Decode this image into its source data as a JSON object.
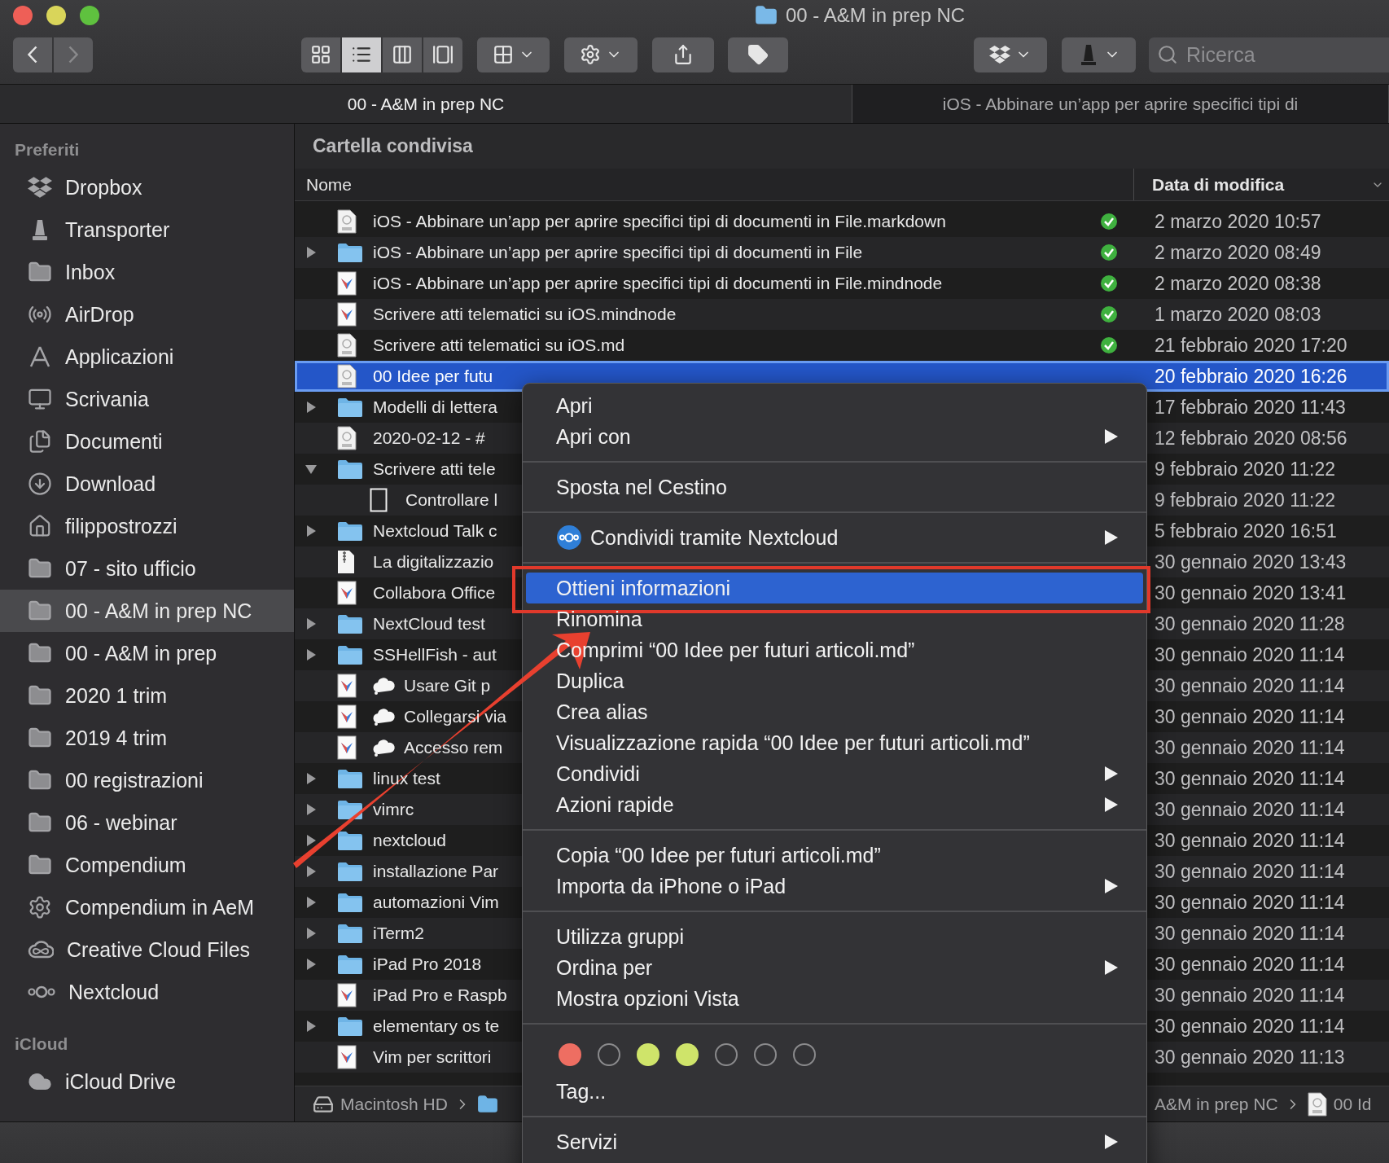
{
  "window": {
    "title": "00 - A&M in prep NC"
  },
  "toolbar": {
    "view_modes": [
      {
        "selected": false
      },
      {
        "selected": true
      },
      {
        "selected": false
      },
      {
        "selected": false
      }
    ],
    "search": {
      "placeholder": "Ricerca"
    }
  },
  "tabs": [
    {
      "label": "00 - A&M in prep NC",
      "selected": true
    },
    {
      "label": "iOS - Abbinare un’app per aprire specifici tipi di",
      "selected": false
    }
  ],
  "sidebar": {
    "sections": [
      {
        "heading": "Preferiti",
        "items": [
          {
            "label": "Dropbox",
            "kind": "dropbox",
            "selected": false
          },
          {
            "label": "Transporter",
            "kind": "transporter",
            "selected": false
          },
          {
            "label": "Inbox",
            "kind": "folder",
            "selected": false
          },
          {
            "label": "AirDrop",
            "kind": "airdrop",
            "selected": false
          },
          {
            "label": "Applicazioni",
            "kind": "apps",
            "selected": false
          },
          {
            "label": "Scrivania",
            "kind": "desktop",
            "selected": false
          },
          {
            "label": "Documenti",
            "kind": "documents",
            "selected": false
          },
          {
            "label": "Download",
            "kind": "download",
            "selected": false
          },
          {
            "label": "filippostrozzi",
            "kind": "home",
            "selected": false
          },
          {
            "label": "07 - sito ufficio",
            "kind": "folder",
            "selected": false
          },
          {
            "label": "00 - A&M in prep NC",
            "kind": "folder",
            "selected": true
          },
          {
            "label": "00 - A&M in prep",
            "kind": "folder",
            "selected": false
          },
          {
            "label": "2020 1 trim",
            "kind": "folder",
            "selected": false
          },
          {
            "label": "2019 4 trim",
            "kind": "folder",
            "selected": false
          },
          {
            "label": "00 registrazioni",
            "kind": "folder",
            "selected": false
          },
          {
            "label": "06 - webinar",
            "kind": "folder",
            "selected": false
          },
          {
            "label": "Compendium",
            "kind": "folder",
            "selected": false
          },
          {
            "label": "Compendium in AeM",
            "kind": "gear",
            "selected": false
          },
          {
            "label": "Creative Cloud Files",
            "kind": "creative-cloud",
            "selected": false
          },
          {
            "label": "Nextcloud",
            "kind": "nextcloud",
            "selected": false
          }
        ]
      },
      {
        "heading": "iCloud",
        "items": [
          {
            "label": "iCloud Drive",
            "kind": "icloud",
            "selected": false
          }
        ]
      }
    ]
  },
  "content": {
    "header": "Cartella condivisa",
    "columns": [
      "Nome",
      "Data di modifica"
    ],
    "rows": [
      {
        "kind": "markdown",
        "name": "iOS - Abbinare un’app per aprire specifici tipi di documenti in File.markdown",
        "date": "2 marzo 2020 10:57",
        "synced": true,
        "cloud": false,
        "selected": false
      },
      {
        "kind": "folder",
        "name": "iOS - Abbinare un’app per aprire specifici tipi di documenti in File",
        "date": "2 marzo 2020 08:49",
        "synced": true,
        "cloud": false,
        "selected": false,
        "expanded": false
      },
      {
        "kind": "mindnode",
        "name": "iOS - Abbinare un’app per aprire specifici tipi di documenti in File.mindnode",
        "date": "2 marzo 2020 08:38",
        "synced": true,
        "cloud": false,
        "selected": false
      },
      {
        "kind": "mindnode",
        "name": "Scrivere atti telematici su iOS.mindnode",
        "date": "1 marzo 2020 08:03",
        "synced": true,
        "cloud": false,
        "selected": false
      },
      {
        "kind": "markdown",
        "name": "Scrivere atti telematici su iOS.md",
        "date": "21 febbraio 2020 17:20",
        "synced": true,
        "cloud": false,
        "selected": false
      },
      {
        "kind": "markdown",
        "name": "00 Idee per futu",
        "date": "20 febbraio 2020 16:26",
        "synced": false,
        "cloud": false,
        "selected": true
      },
      {
        "kind": "folder",
        "name": "Modelli di lettera",
        "date": "17 febbraio 2020 11:43",
        "synced": false,
        "cloud": false,
        "selected": false,
        "expanded": false
      },
      {
        "kind": "markdown",
        "name": "2020-02-12 - #",
        "date": "12 febbraio 2020 08:56",
        "synced": false,
        "cloud": false,
        "selected": false
      },
      {
        "kind": "folder",
        "name": "Scrivere atti tele",
        "date": "9 febbraio 2020 11:22",
        "synced": false,
        "cloud": false,
        "selected": false,
        "expanded": true,
        "children": [
          {
            "kind": "blank",
            "name": "Controllare l",
            "date": "9 febbraio 2020 11:22",
            "synced": false,
            "cloud": false,
            "selected": false
          }
        ]
      },
      {
        "kind": "folder",
        "name": "Nextcloud Talk c",
        "date": "5 febbraio 2020 16:51",
        "synced": false,
        "cloud": false,
        "selected": false,
        "expanded": false
      },
      {
        "kind": "zip",
        "name": "La digitalizzazio",
        "date": "30 gennaio 2020 13:43",
        "synced": false,
        "cloud": false,
        "selected": false
      },
      {
        "kind": "mindnode",
        "name": "Collabora Office",
        "date": "30 gennaio 2020 13:41",
        "synced": false,
        "cloud": false,
        "selected": false
      },
      {
        "kind": "folder",
        "name": "NextCloud test",
        "date": "30 gennaio 2020 11:28",
        "synced": false,
        "cloud": false,
        "selected": false,
        "expanded": false
      },
      {
        "kind": "folder",
        "name": "SSHellFish - aut",
        "date": "30 gennaio 2020 11:14",
        "synced": false,
        "cloud": false,
        "selected": false,
        "expanded": false
      },
      {
        "kind": "mindnode",
        "name": "Usare Git p",
        "date": "30 gennaio 2020 11:14",
        "synced": false,
        "cloud": true,
        "selected": false
      },
      {
        "kind": "mindnode",
        "name": "Collegarsi via",
        "date": "30 gennaio 2020 11:14",
        "synced": false,
        "cloud": true,
        "selected": false
      },
      {
        "kind": "mindnode",
        "name": "Accesso rem",
        "date": "30 gennaio 2020 11:14",
        "synced": false,
        "cloud": true,
        "selected": false
      },
      {
        "kind": "folder",
        "name": "linux test",
        "date": "30 gennaio 2020 11:14",
        "synced": false,
        "cloud": false,
        "selected": false,
        "expanded": false
      },
      {
        "kind": "folder",
        "name": "vimrc",
        "date": "30 gennaio 2020 11:14",
        "synced": false,
        "cloud": false,
        "selected": false,
        "expanded": false
      },
      {
        "kind": "folder",
        "name": "nextcloud",
        "date": "30 gennaio 2020 11:14",
        "synced": false,
        "cloud": false,
        "selected": false,
        "expanded": false
      },
      {
        "kind": "folder",
        "name": "installazione Par",
        "date": "30 gennaio 2020 11:14",
        "synced": false,
        "cloud": false,
        "selected": false,
        "expanded": false
      },
      {
        "kind": "folder",
        "name": "automazioni Vim",
        "date": "30 gennaio 2020 11:14",
        "synced": false,
        "cloud": false,
        "selected": false,
        "expanded": false
      },
      {
        "kind": "folder",
        "name": "iTerm2",
        "date": "30 gennaio 2020 11:14",
        "synced": false,
        "cloud": false,
        "selected": false,
        "expanded": false
      },
      {
        "kind": "folder",
        "name": "iPad Pro 2018",
        "date": "30 gennaio 2020 11:14",
        "synced": false,
        "cloud": false,
        "selected": false,
        "expanded": false
      },
      {
        "kind": "mindnode",
        "name": "iPad Pro e Raspb",
        "date": "30 gennaio 2020 11:14",
        "synced": false,
        "cloud": false,
        "selected": false
      },
      {
        "kind": "folder",
        "name": "elementary os te",
        "date": "30 gennaio 2020 11:14",
        "synced": false,
        "cloud": false,
        "selected": false,
        "expanded": false
      },
      {
        "kind": "mindnode",
        "name": "Vim per scrittori",
        "date": "30 gennaio 2020 11:13",
        "synced": false,
        "cloud": false,
        "selected": false
      }
    ]
  },
  "path_bar": {
    "start": [
      "Macintosh HD"
    ],
    "end": [
      "A&M in prep NC",
      "00 Id"
    ]
  },
  "context_menu": {
    "items": [
      {
        "kind": "item",
        "label": "Apri",
        "submenu": false,
        "selected": false
      },
      {
        "kind": "item",
        "label": "Apri con",
        "submenu": true,
        "selected": false
      },
      {
        "kind": "separator"
      },
      {
        "kind": "item",
        "label": "Sposta nel Cestino",
        "submenu": false,
        "selected": false
      },
      {
        "kind": "separator"
      },
      {
        "kind": "icon-item",
        "label": "Condividi tramite Nextcloud",
        "submenu": true,
        "selected": false
      },
      {
        "kind": "separator"
      },
      {
        "kind": "item",
        "label": "Ottieni informazioni",
        "submenu": false,
        "selected": true
      },
      {
        "kind": "item",
        "label": "Rinomina",
        "submenu": false,
        "selected": false
      },
      {
        "kind": "item",
        "label": "Comprimi “00 Idee per futuri articoli.md”",
        "submenu": false,
        "selected": false
      },
      {
        "kind": "item",
        "label": "Duplica",
        "submenu": false,
        "selected": false
      },
      {
        "kind": "item",
        "label": "Crea alias",
        "submenu": false,
        "selected": false
      },
      {
        "kind": "item",
        "label": "Visualizzazione rapida “00 Idee per futuri articoli.md”",
        "submenu": false,
        "selected": false
      },
      {
        "kind": "item",
        "label": "Condividi",
        "submenu": true,
        "selected": false
      },
      {
        "kind": "item",
        "label": "Azioni rapide",
        "submenu": true,
        "selected": false
      },
      {
        "kind": "separator"
      },
      {
        "kind": "item",
        "label": "Copia “00 Idee per futuri articoli.md”",
        "submenu": false,
        "selected": false
      },
      {
        "kind": "item",
        "label": "Importa da iPhone o iPad",
        "submenu": true,
        "selected": false
      },
      {
        "kind": "separator"
      },
      {
        "kind": "item",
        "label": "Utilizza gruppi",
        "submenu": false,
        "selected": false
      },
      {
        "kind": "item",
        "label": "Ordina per",
        "submenu": true,
        "selected": false
      },
      {
        "kind": "item",
        "label": "Mostra opzioni Vista",
        "submenu": false,
        "selected": false
      },
      {
        "kind": "separator"
      },
      {
        "kind": "tags",
        "tags": [
          {
            "filled": true,
            "color": "#ee6e62"
          },
          {
            "filled": false
          },
          {
            "filled": true,
            "color": "#cfe46a"
          },
          {
            "filled": true,
            "color": "#cfe46a"
          },
          {
            "filled": false
          },
          {
            "filled": false
          },
          {
            "filled": false
          }
        ]
      },
      {
        "kind": "item",
        "label": "Tag...",
        "submenu": false,
        "selected": false
      },
      {
        "kind": "separator"
      },
      {
        "kind": "item",
        "label": "Servizi",
        "submenu": true,
        "selected": false
      }
    ]
  }
}
